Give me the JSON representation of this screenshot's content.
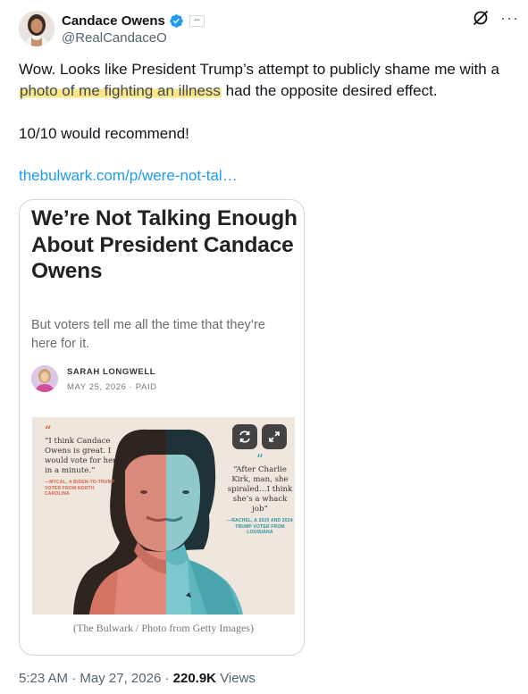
{
  "post": {
    "author_name": "Candace Owens",
    "author_handle": "@RealCandaceO",
    "text_before_highlight": "Wow. Looks like President Trump’s attempt to publicly shame me with a ",
    "text_highlight": "photo of me fighting an illness",
    "text_after_highlight": " had the opposite desired effect.",
    "text_line2": "10/10 would recommend!",
    "link": "thebulwark.com/p/were-not-tal…",
    "time": "5:23 AM",
    "separator": "·",
    "date": "May 27, 2026",
    "views_count": "220.9K",
    "views_label": "Views"
  },
  "card": {
    "title": "We’re Not Talking Enough About President Candace Owens",
    "subtitle": "But voters tell me all the time that they’re here for it.",
    "author": "SARAH LONGWELL",
    "date_line": "MAY 25, 2026 · PAID",
    "caption": "(The Bulwark / Photo from Getty Images)"
  },
  "art": {
    "quote_left": "“I think Candace Owens is great. I would vote for her in a minute.”",
    "attr_left": "—MYCAL, A BIDEN-TO-TRUMP VOTER FROM NORTH CAROLINA",
    "quote_right": "“After Charlie Kirk, man, she spiraled…I think she’s a whack job”",
    "attr_right": "—RACHEL, A 2020 AND 2024 TRUMP VOTER FROM LOUISIANA",
    "open_quote": "“",
    "close_quote": "”"
  },
  "icons": {
    "verified": "verified-badge-icon",
    "affiliate": "affiliate-badge-icon",
    "grok": "grok-icon",
    "more": "more-icon",
    "refresh": "refresh-icon",
    "expand": "expand-icon"
  },
  "colors": {
    "link": "#1d9bf0",
    "highlight": "#fde68a",
    "secondary_text": "#536471",
    "verified": "#1d9bf0",
    "left_accent": "#d8604a",
    "right_accent": "#2aa6b0"
  }
}
